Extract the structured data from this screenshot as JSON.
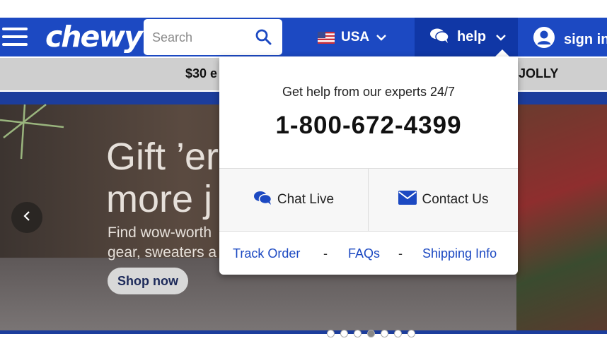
{
  "header": {
    "logo": "chewy",
    "search": {
      "placeholder": "Search",
      "value": ""
    },
    "country": "USA",
    "help": "help",
    "signin": "sign in"
  },
  "promo": {
    "left_text": "$30 e",
    "right_text": "JOLLY"
  },
  "hero": {
    "title_line1": "Gift ’er",
    "title_line2": "more j",
    "sub_line1": "Find wow-worth",
    "sub_line2": "gear, sweaters a",
    "button": "Shop now",
    "carousel": {
      "slides": 7,
      "active_index": 3
    }
  },
  "help_popup": {
    "tagline": "Get help from our experts 24/7",
    "phone": "1-800-672-4399",
    "chat": "Chat Live",
    "contact": "Contact Us",
    "links": [
      "Track Order",
      "FAQs",
      "Shipping Info"
    ],
    "separator": "-"
  },
  "colors": {
    "brand_blue": "#1c49c2",
    "help_active_blue": "#1037a6",
    "promo_gray": "#cfcfcf"
  },
  "icons": [
    "hamburger-icon",
    "search-icon",
    "us-flag-icon",
    "chevron-down-icon",
    "chat-bubbles-icon",
    "user-icon",
    "chevron-left-icon",
    "envelope-icon"
  ]
}
